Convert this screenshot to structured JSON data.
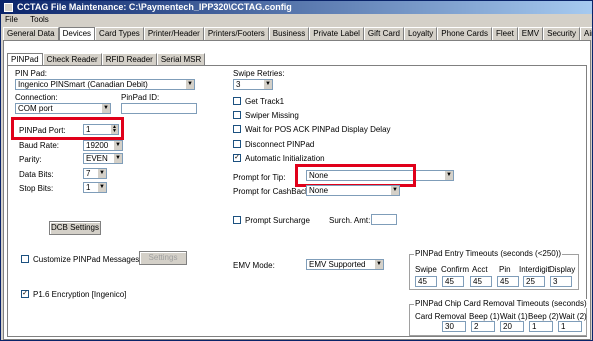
{
  "window": {
    "title": "CCTAG File Maintenance: C:\\Paymentech_IPP320\\CCTAG.config"
  },
  "menu": [
    "File",
    "Tools"
  ],
  "main_tabs": [
    "General Data",
    "Devices",
    "Card Types",
    "Printer/Header",
    "Printers/Footers",
    "Business",
    "Private Label",
    "Gift Card",
    "Loyalty",
    "Phone Cards",
    "Fleet",
    "EMV",
    "Security",
    "Air Miles"
  ],
  "sub_tabs": [
    "PINPad",
    "Check Reader",
    "RFID Reader",
    "Serial MSR"
  ],
  "left": {
    "pinpad_label": "PIN Pad:",
    "pinpad_value": "Ingenico PINSmart (Canadian Debit)",
    "connection_label": "Connection:",
    "connection_value": "COM port",
    "pinpad_id_label": "PinPad ID:",
    "pinpad_id_value": "",
    "port_label": "PINPad Port:",
    "port_value": "1",
    "baud_label": "Baud Rate:",
    "baud_value": "19200",
    "parity_label": "Parity:",
    "parity_value": "EVEN",
    "databits_label": "Data Bits:",
    "databits_value": "7",
    "stopbits_label": "Stop Bits:",
    "stopbits_value": "1",
    "dcb_button": "DCB Settings",
    "customize_label": "Customize PINPad Messages",
    "settings_button": "Settings",
    "p16_label": "P1.6 Encryption [Ingenico]"
  },
  "right": {
    "swipe_retries_label": "Swipe Retries:",
    "swipe_retries_value": "3",
    "get_track1": "Get Track1",
    "swiper_missing": "Swiper Missing",
    "wait_ack": "Wait for POS ACK PINPad Display Delay",
    "disconnect": "Disconnect PINPad",
    "auto_init": "Automatic Initialization",
    "prompt_tip_label": "Prompt for Tip:",
    "prompt_tip_value": "None",
    "prompt_cashback_label": "Prompt for CashBack:",
    "prompt_cashback_value": "None",
    "prompt_surcharge": "Prompt Surcharge",
    "surch_amt_label": "Surch. Amt:",
    "surch_amt_value": "",
    "emv_mode_label": "EMV Mode:",
    "emv_mode_value": "EMV Supported"
  },
  "timeouts": {
    "title": "PINPad Entry Timeouts (seconds (<250))",
    "headers": [
      "Swipe",
      "Confirm",
      "Acct",
      "Pin",
      "Interdigit",
      "Display"
    ],
    "values": [
      "45",
      "45",
      "45",
      "45",
      "25",
      "3"
    ]
  },
  "chip": {
    "title": "PINPad Chip Card Removal Timeouts (seconds)",
    "headers": [
      "Card Removal",
      "Beep (1)",
      "Wait (1)",
      "Beep (2)",
      "Wait (2)"
    ],
    "values": [
      "30",
      "2",
      "20",
      "1",
      "1"
    ]
  },
  "colors": {
    "highlight": "#e0001a",
    "title_bar": "#0a246a"
  }
}
